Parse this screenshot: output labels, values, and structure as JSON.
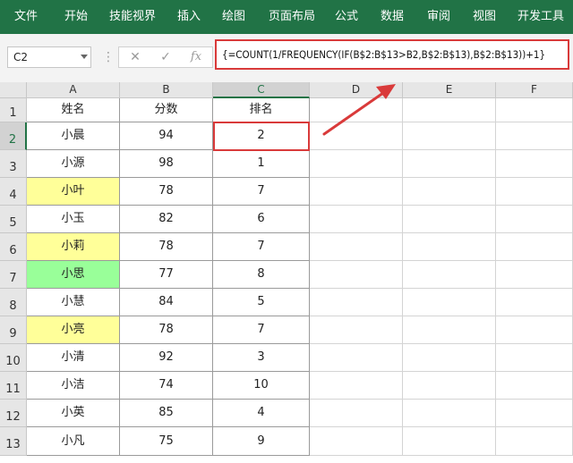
{
  "menu": {
    "items": [
      "文件",
      "开始",
      "技能视界",
      "插入",
      "绘图",
      "页面布局",
      "公式",
      "数据",
      "审阅",
      "视图",
      "开发工具"
    ]
  },
  "formula_bar": {
    "name_box": "C2",
    "cancel_glyph": "✕",
    "confirm_glyph": "✓",
    "fx_glyph": "fx",
    "formula": "{=COUNT(1/FREQUENCY(IF(B$2:B$13>B2,B$2:B$13),B$2:B$13))+1}"
  },
  "columns": [
    "A",
    "B",
    "C",
    "D",
    "E",
    "F"
  ],
  "rows": [
    "1",
    "2",
    "3",
    "4",
    "5",
    "6",
    "7",
    "8",
    "9",
    "10",
    "11",
    "12",
    "13"
  ],
  "grid": [
    [
      "姓名",
      "分数",
      "排名"
    ],
    [
      "小晨",
      "94",
      "2"
    ],
    [
      "小源",
      "98",
      "1"
    ],
    [
      "小叶",
      "78",
      "7"
    ],
    [
      "小玉",
      "82",
      "6"
    ],
    [
      "小莉",
      "78",
      "7"
    ],
    [
      "小思",
      "77",
      "8"
    ],
    [
      "小慧",
      "84",
      "5"
    ],
    [
      "小亮",
      "78",
      "7"
    ],
    [
      "小清",
      "92",
      "3"
    ],
    [
      "小洁",
      "74",
      "10"
    ],
    [
      "小英",
      "85",
      "4"
    ],
    [
      "小凡",
      "75",
      "9"
    ]
  ],
  "colors": {
    "ribbon": "#217346",
    "highlight_yellow": "#ffff99",
    "highlight_green": "#99ff99",
    "annotation_red": "#d93a3a"
  },
  "highlights": {
    "A4": "yellow",
    "A6": "yellow",
    "A7": "green",
    "A9": "yellow"
  },
  "selected_cell": "C2",
  "icons": [
    "name-box-dropdown-icon",
    "cancel-icon",
    "confirm-icon",
    "fx-icon",
    "arrow-annotation"
  ]
}
